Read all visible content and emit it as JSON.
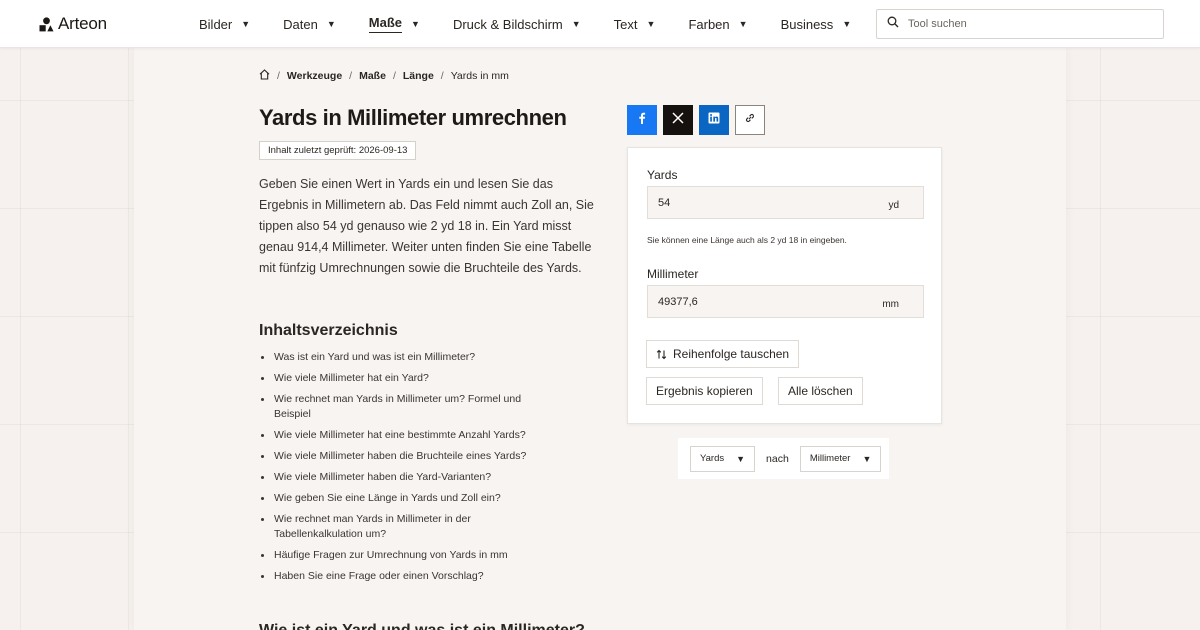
{
  "brand": {
    "name": "Arteon"
  },
  "nav": {
    "items": [
      {
        "label": "Bilder",
        "active": false
      },
      {
        "label": "Daten",
        "active": false
      },
      {
        "label": "Maße",
        "active": true
      },
      {
        "label": "Druck & Bildschirm",
        "active": false
      },
      {
        "label": "Text",
        "active": false
      },
      {
        "label": "Farben",
        "active": false
      },
      {
        "label": "Business",
        "active": false
      }
    ],
    "caret": "▼"
  },
  "search": {
    "placeholder": "Tool suchen"
  },
  "breadcrumb": {
    "items": [
      "Werkzeuge",
      "Maße",
      "Länge"
    ],
    "current": "Yards in mm",
    "separator": "/"
  },
  "page": {
    "title": "Yards in Millimeter umrechnen",
    "badge": "Inhalt zuletzt geprüft: 2026-09-13",
    "intro": "Geben Sie einen Wert in Yards ein und lesen Sie das Ergebnis in Millimetern ab. Das Feld nimmt auch Zoll an, Sie tippen also 54 yd genauso wie 2 yd 18 in. Ein Yard misst genau 914,4 Millimeter. Weiter unten finden Sie eine Tabelle mit fünfzig Umrechnungen sowie die Bruchteile des Yards."
  },
  "toc": {
    "title": "Inhaltsverzeichnis",
    "items": [
      "Was ist ein Yard und was ist ein Millimeter?",
      "Wie viele Millimeter hat ein Yard?",
      "Wie rechnet man Yards in Millimeter um? Formel und Beispiel",
      "Wie viele Millimeter hat eine bestimmte Anzahl Yards?",
      "Wie viele Millimeter haben die Bruchteile eines Yards?",
      "Wie viele Millimeter haben die Yard-Varianten?",
      "Wie geben Sie eine Länge in Yards und Zoll ein?",
      "Wie rechnet man Yards in Millimeter in der Tabellenkalkulation um?",
      "Häufige Fragen zur Umrechnung von Yards in mm",
      "Haben Sie eine Frage oder einen Vorschlag?"
    ]
  },
  "next_heading": "Wie ist ein Yard und was ist ein Millimeter?",
  "share": {
    "icons": [
      "facebook-icon",
      "x-icon",
      "linkedin-icon",
      "link-icon"
    ],
    "colors": {
      "facebook": "#1877f2",
      "x": "#14110f",
      "linkedin": "#0a66c2"
    }
  },
  "converter": {
    "from_label": "Yards",
    "from_value": "54",
    "from_unit": "yd",
    "hint": "Sie können eine Länge auch als 2 yd 18 in eingeben.",
    "to_label": "Millimeter",
    "to_value": "49377,6",
    "to_unit": "mm",
    "swap_label": "Reihenfolge tauschen",
    "copy_label": "Ergebnis kopieren",
    "clear_label": "Alle löschen"
  },
  "unit_selector": {
    "from": "Yards",
    "connector": "nach",
    "to": "Millimeter",
    "caret": "▼"
  }
}
